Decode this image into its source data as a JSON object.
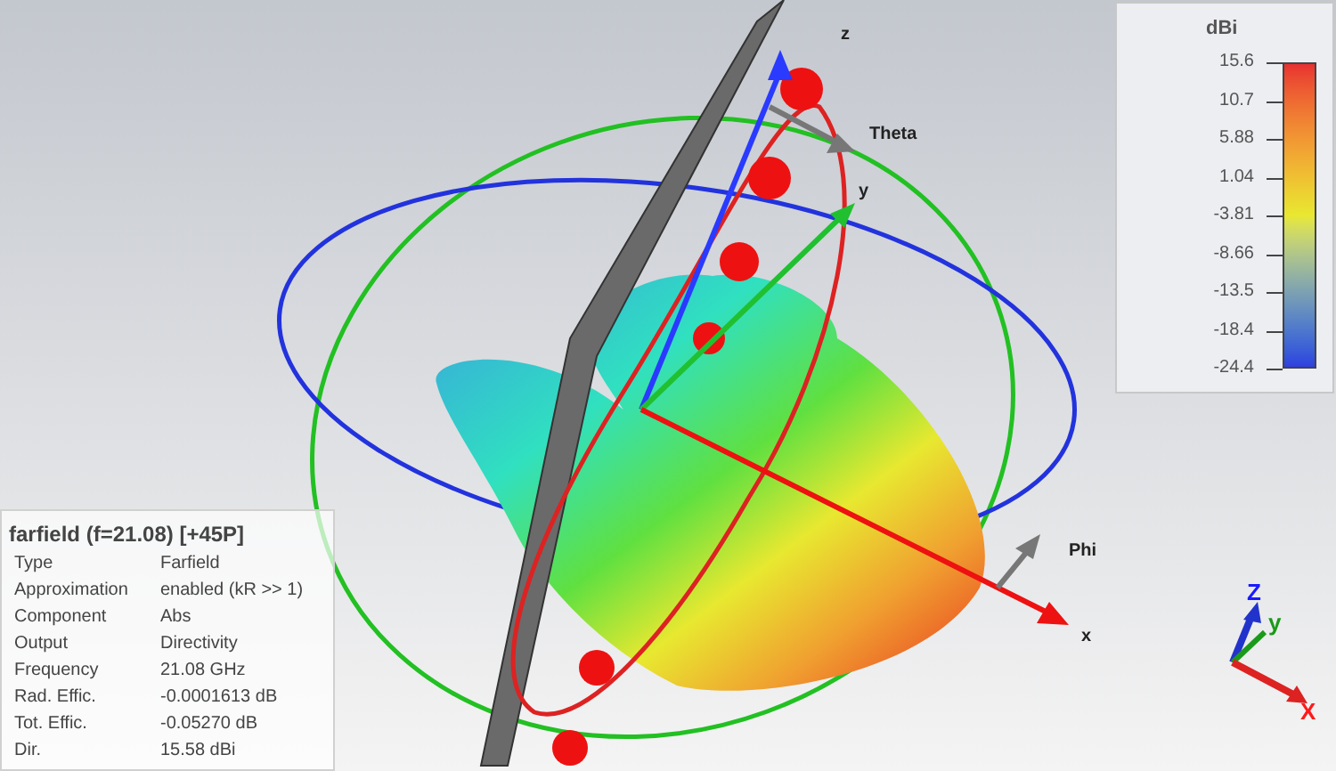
{
  "scene_labels": [
    {
      "text": "z"
    },
    {
      "text": "Theta"
    },
    {
      "text": "y"
    },
    {
      "text": "Phi"
    },
    {
      "text": "x"
    }
  ],
  "triad": [
    {
      "text": "Z",
      "color": "#1a1aff"
    },
    {
      "text": "y",
      "color": "#1a9a1a"
    },
    {
      "text": "X",
      "color": "#ff1a1a"
    }
  ],
  "colorbar": {
    "unit": "dBi",
    "ticks": [
      "15.6",
      "10.7",
      "5.88",
      "1.04",
      "-3.81",
      "-8.66",
      "-13.5",
      "-18.4",
      "-24.4"
    ]
  },
  "info": {
    "title": "farfield (f=21.08) [+45P]",
    "rows": [
      {
        "label": "Type",
        "value": "Farfield"
      },
      {
        "label": "Approximation",
        "value": "enabled (kR >> 1)"
      },
      {
        "label": "Component",
        "value": "Abs"
      },
      {
        "label": "Output",
        "value": "Directivity"
      },
      {
        "label": "Frequency",
        "value": "21.08 GHz"
      },
      {
        "label": "Rad. Effic.",
        "value": "-0.0001613 dB"
      },
      {
        "label": "Tot. Effic.",
        "value": "-0.05270 dB"
      },
      {
        "label": "Dir.",
        "value": "15.58 dBi"
      }
    ]
  }
}
